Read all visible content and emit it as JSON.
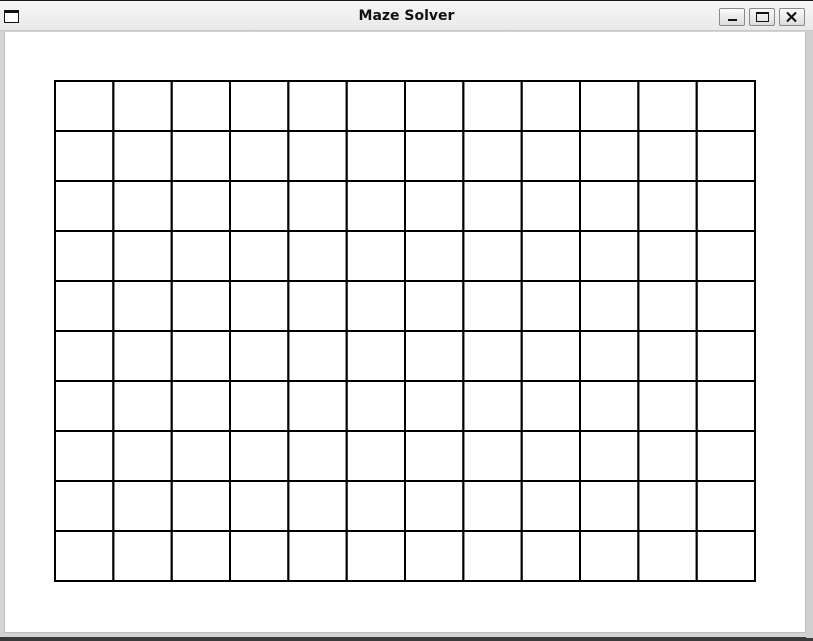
{
  "window": {
    "title": "Maze Solver",
    "icon": "window-icon",
    "controls": {
      "minimize": "minimize-icon",
      "maximize": "maximize-icon",
      "close": "close-icon"
    }
  },
  "maze": {
    "columns": 12,
    "rows": 10,
    "background": "#ffffff",
    "line_color": "#000000"
  }
}
